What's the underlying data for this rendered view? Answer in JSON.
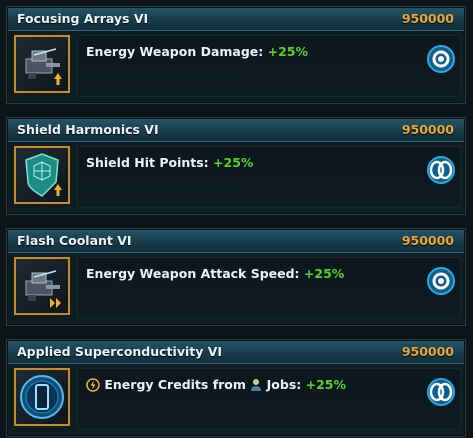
{
  "cards": [
    {
      "title": "Focusing Arrays VI",
      "cost": "950000",
      "effect_label": "Energy Weapon Damage:",
      "effect_value": "+25%",
      "icon": "energy-weapon-icon",
      "badge": "engineering-badge-icon"
    },
    {
      "title": "Shield Harmonics VI",
      "cost": "950000",
      "effect_label": "Shield Hit Points:",
      "effect_value": "+25%",
      "icon": "shield-icon",
      "badge": "physics-badge-icon"
    },
    {
      "title": "Flash Coolant VI",
      "cost": "950000",
      "effect_label": "Energy Weapon Attack Speed:",
      "effect_value": "+25%",
      "icon": "energy-weapon-icon",
      "badge": "engineering-badge-icon"
    },
    {
      "title": "Applied Superconductivity VI",
      "cost": "950000",
      "effect_label_1": "Energy Credits from",
      "effect_label_2": "Jobs:",
      "effect_value": "+25%",
      "icon": "power-cell-icon",
      "badge": "physics-badge-icon"
    }
  ],
  "colors": {
    "cost": "#e8a93a",
    "positive": "#58d12a",
    "icon_frame": "#c88a24"
  }
}
